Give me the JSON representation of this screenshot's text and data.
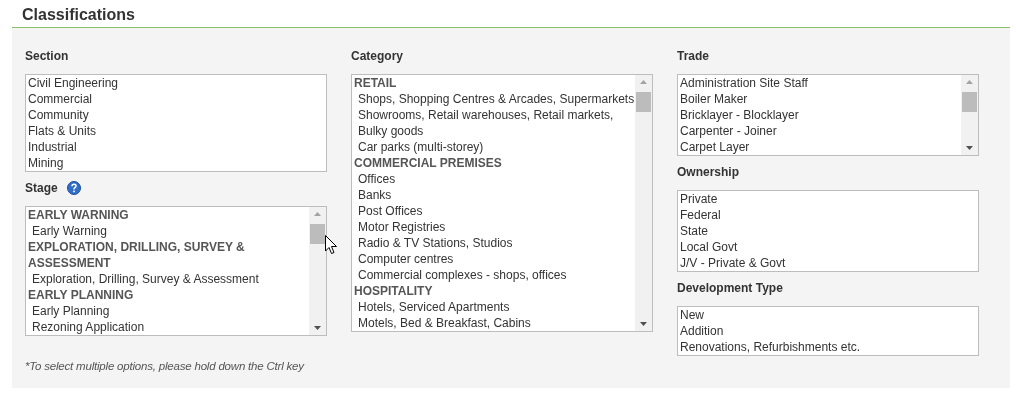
{
  "title": "Classifications",
  "columns": [
    {
      "fields": [
        {
          "label": "Section",
          "help": false,
          "scrollbar": false,
          "options": [
            {
              "label": "Civil Engineering"
            },
            {
              "label": "Commercial"
            },
            {
              "label": "Community"
            },
            {
              "label": "Flats & Units"
            },
            {
              "label": "Industrial"
            },
            {
              "label": "Mining"
            }
          ]
        },
        {
          "label": "Stage",
          "help": true,
          "scrollbar": true,
          "options": [
            {
              "label": "EARLY WARNING",
              "children": [
                {
                  "label": "Early Warning"
                }
              ]
            },
            {
              "label": "EXPLORATION, DRILLING, SURVEY & ASSESSMENT",
              "children": [
                {
                  "label": "Exploration, Drilling, Survey & Assessment"
                }
              ]
            },
            {
              "label": "EARLY PLANNING",
              "children": [
                {
                  "label": "Early Planning"
                },
                {
                  "label": "Rezoning Application"
                }
              ]
            }
          ]
        }
      ],
      "note": "*To select multiple options, please hold down the Ctrl key"
    },
    {
      "fields": [
        {
          "label": "Category",
          "help": false,
          "scrollbar": true,
          "options": [
            {
              "label": "RETAIL",
              "children": [
                {
                  "label": "Shops, Shopping Centres & Arcades, Supermarkets"
                },
                {
                  "label": "Showrooms, Retail warehouses, Retail markets,"
                },
                {
                  "label": "Bulky goods"
                },
                {
                  "label": "Car parks (multi-storey)"
                }
              ]
            },
            {
              "label": "COMMERCIAL PREMISES",
              "children": [
                {
                  "label": "Offices"
                },
                {
                  "label": "Banks"
                },
                {
                  "label": "Post Offices"
                },
                {
                  "label": "Motor Registries"
                },
                {
                  "label": "Radio & TV Stations, Studios"
                },
                {
                  "label": "Computer centres"
                },
                {
                  "label": "Commercial complexes - shops, offices"
                }
              ]
            },
            {
              "label": "HOSPITALITY",
              "children": [
                {
                  "label": "Hotels, Serviced Apartments"
                },
                {
                  "label": "Motels, Bed & Breakfast, Cabins"
                }
              ]
            }
          ]
        }
      ]
    },
    {
      "fields": [
        {
          "label": "Trade",
          "help": false,
          "scrollbar": true,
          "options": [
            {
              "label": "Administration Site Staff"
            },
            {
              "label": "Boiler Maker"
            },
            {
              "label": "Bricklayer - Blocklayer"
            },
            {
              "label": "Carpenter - Joiner"
            },
            {
              "label": "Carpet Layer"
            }
          ]
        },
        {
          "label": "Ownership",
          "help": false,
          "scrollbar": false,
          "options": [
            {
              "label": "Private"
            },
            {
              "label": "Federal"
            },
            {
              "label": "State"
            },
            {
              "label": "Local Govt"
            },
            {
              "label": "J/V - Private & Govt"
            }
          ]
        },
        {
          "label": "Development Type",
          "help": false,
          "scrollbar": false,
          "options": [
            {
              "label": "New"
            },
            {
              "label": "Addition"
            },
            {
              "label": "Renovations, Refurbishments etc."
            }
          ]
        }
      ]
    }
  ]
}
